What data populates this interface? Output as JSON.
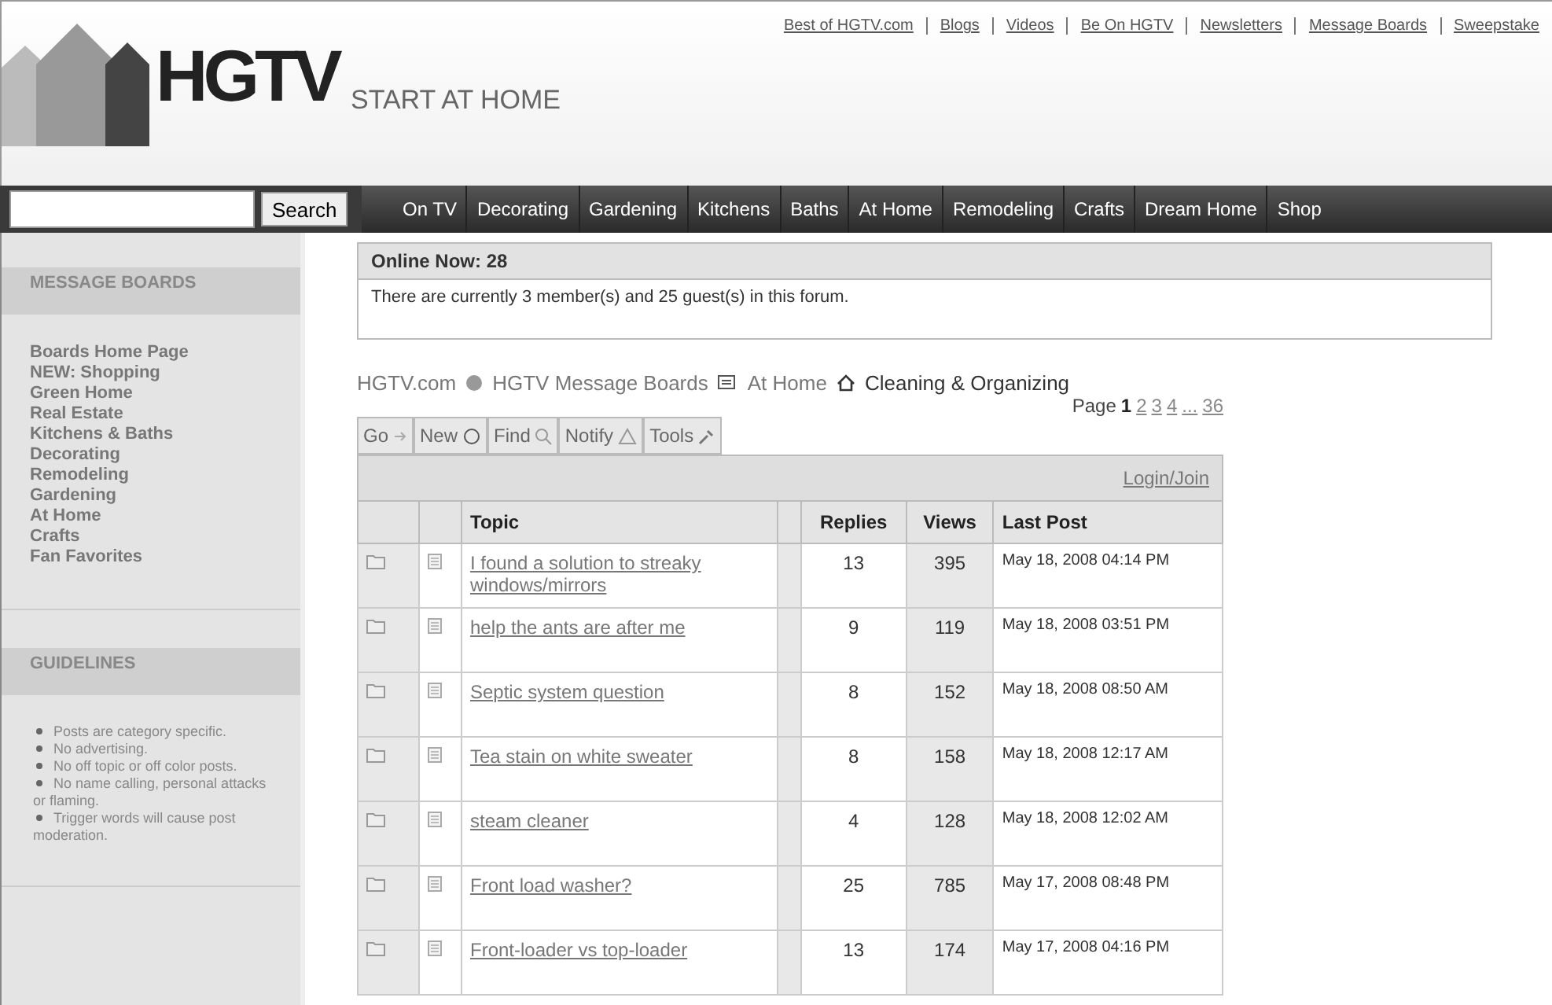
{
  "top_links": [
    "Best of HGTV.com",
    "Blogs",
    "Videos",
    "Be On HGTV",
    "Newsletters",
    "Message Boards",
    "Sweepstake"
  ],
  "logo": {
    "brand": "HGTV",
    "tagline": "START AT HOME"
  },
  "search": {
    "button": "Search"
  },
  "nav": [
    "On TV",
    "Decorating",
    "Gardening",
    "Kitchens",
    "Baths",
    "At Home",
    "Remodeling",
    "Crafts",
    "Dream Home",
    "Shop"
  ],
  "sidebar": [
    {
      "title": "MESSAGE BOARDS",
      "kind": "links",
      "items": [
        "Boards Home Page",
        "NEW: Shopping",
        "Green Home",
        "Real Estate",
        "Kitchens & Baths",
        "Decorating",
        "Remodeling",
        "Gardening",
        "At Home",
        "Crafts",
        "Fan Favorites"
      ]
    },
    {
      "title": "GUIDELINES",
      "kind": "bullets",
      "items": [
        "Posts are category specific.",
        "No advertising.",
        "No off topic or off color posts.",
        "No name calling, personal attacks or flaming.",
        "Trigger words will cause post moderation."
      ]
    }
  ],
  "online": {
    "title": "Online Now: 28",
    "text": "There are currently 3 member(s) and 25 guest(s) in this forum."
  },
  "breadcrumb": [
    {
      "label": "HGTV.com",
      "link": true
    },
    {
      "label": "HGTV Message Boards",
      "link": true
    },
    {
      "label": "At Home",
      "link": true
    },
    {
      "label": "Cleaning & Organizing",
      "link": false
    }
  ],
  "pagination": {
    "label": "Page",
    "pages": [
      {
        "label": "1",
        "selected": true
      },
      {
        "label": "2",
        "selected": false
      },
      {
        "label": "3",
        "selected": false
      },
      {
        "label": "4",
        "selected": false
      },
      {
        "label": "...",
        "selected": false
      },
      {
        "label": "36",
        "selected": false
      }
    ]
  },
  "toolbar": [
    "Go",
    "New",
    "Find",
    "Notify",
    "Tools"
  ],
  "table": {
    "login": "Login/Join",
    "columns": [
      "Topic",
      "Replies",
      "Views",
      "Last Post"
    ],
    "rows": [
      {
        "topic": "I found a solution to streaky windows/mirrors",
        "replies": "13",
        "views": "395",
        "last_post": "May 18, 2008 04:14 PM"
      },
      {
        "topic": "help the ants are after me",
        "replies": "9",
        "views": "119",
        "last_post": "May 18, 2008 03:51 PM"
      },
      {
        "topic": "Septic system question",
        "replies": "8",
        "views": "152",
        "last_post": "May 18, 2008 08:50 AM"
      },
      {
        "topic": "Tea stain on white sweater",
        "replies": "8",
        "views": "158",
        "last_post": "May 18, 2008 12:17 AM"
      },
      {
        "topic": "steam cleaner",
        "replies": "4",
        "views": "128",
        "last_post": "May 18, 2008 12:02 AM"
      },
      {
        "topic": "Front load washer?",
        "replies": "25",
        "views": "785",
        "last_post": "May 17, 2008 08:48 PM"
      },
      {
        "topic": "Front-loader vs top-loader",
        "replies": "13",
        "views": "174",
        "last_post": "May 17, 2008 04:16 PM"
      }
    ]
  }
}
